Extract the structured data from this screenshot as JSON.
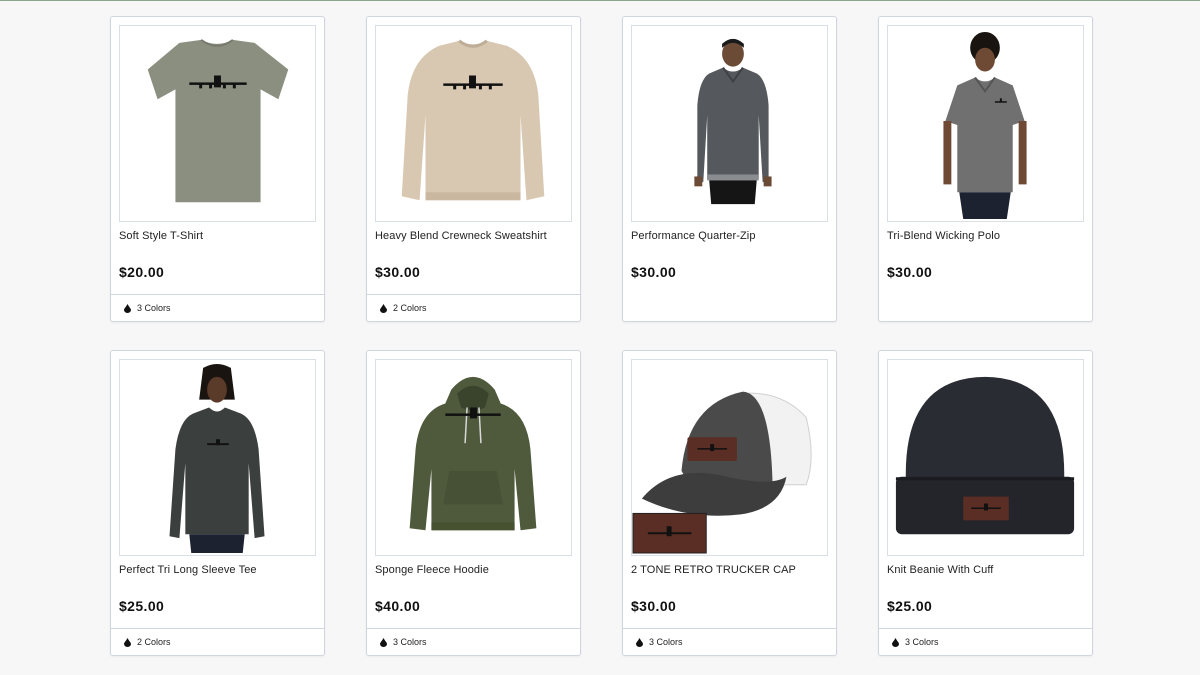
{
  "products": [
    {
      "name": "Soft Style T-Shirt",
      "price": "$20.00",
      "colors": "3 Colors",
      "image": "tshirt-image"
    },
    {
      "name": "Heavy Blend Crewneck Sweatshirt",
      "price": "$30.00",
      "colors": "2 Colors",
      "image": "sweatshirt-image"
    },
    {
      "name": "Performance Quarter-Zip",
      "price": "$30.00",
      "colors": "",
      "image": "quarter-zip-image"
    },
    {
      "name": "Tri-Blend Wicking Polo",
      "price": "$30.00",
      "colors": "",
      "image": "polo-image"
    },
    {
      "name": "Perfect Tri Long Sleeve Tee",
      "price": "$25.00",
      "colors": "2 Colors",
      "image": "long-sleeve-image"
    },
    {
      "name": "Sponge Fleece Hoodie",
      "price": "$40.00",
      "colors": "3 Colors",
      "image": "hoodie-image"
    },
    {
      "name": "2 TONE RETRO TRUCKER CAP",
      "price": "$30.00",
      "colors": "3 Colors",
      "image": "trucker-cap-image"
    },
    {
      "name": "Knit Beanie With Cuff",
      "price": "$25.00",
      "colors": "3 Colors",
      "image": "beanie-image"
    }
  ],
  "colors": {
    "tshirt": "#8b8f80",
    "sweatshirt": "#d8c8b2",
    "quarter_zip": "#55585c",
    "polo": "#707070",
    "long_sleeve": "#3b3f3d",
    "hoodie": "#4f5a3c",
    "cap_front": "#4a4a4a",
    "cap_mesh": "#f2f2f2",
    "leather_patch": "#5a2e25",
    "beanie": "#2a2c33"
  }
}
